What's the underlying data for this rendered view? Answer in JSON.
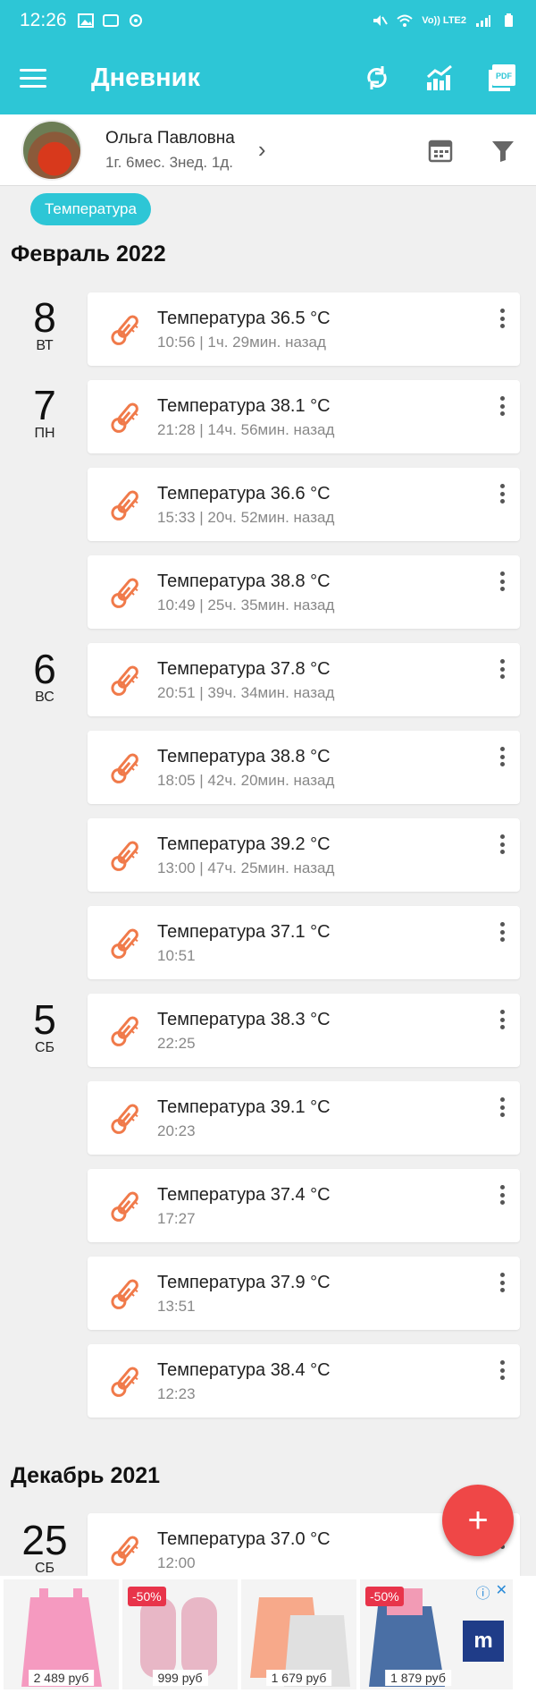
{
  "status_bar": {
    "time": "12:26",
    "carrier": "Vo)) LTE2"
  },
  "app_bar": {
    "title": "Дневник",
    "icons": [
      "menu-icon",
      "sync-icon",
      "stats-icon",
      "pdf-icon"
    ],
    "pdf_label": "PDF"
  },
  "profile": {
    "name": "Ольга Павловна",
    "age": "1г. 6мес. 3нед. 1д."
  },
  "filter_chip": "Температура",
  "months": [
    {
      "label": "Февраль 2022"
    },
    {
      "label": "Декабрь 2021"
    }
  ],
  "days": [
    {
      "num": "8",
      "weekday": "ВТ"
    },
    {
      "num": "7",
      "weekday": "ПН"
    },
    {
      "num": "6",
      "weekday": "ВС"
    },
    {
      "num": "5",
      "weekday": "СБ"
    },
    {
      "num": "25",
      "weekday": "СБ"
    }
  ],
  "entries": [
    {
      "title": "Температура 36.5 °C",
      "time": "10:56",
      "ago": "1ч. 29мин. назад"
    },
    {
      "title": "Температура 38.1 °C",
      "time": "21:28",
      "ago": "14ч. 56мин. назад"
    },
    {
      "title": "Температура 36.6 °C",
      "time": "15:33",
      "ago": "20ч. 52мин. назад"
    },
    {
      "title": "Температура 38.8 °C",
      "time": "10:49",
      "ago": "25ч. 35мин. назад"
    },
    {
      "title": "Температура 37.8 °C",
      "time": "20:51",
      "ago": "39ч. 34мин. назад"
    },
    {
      "title": "Температура 38.8 °C",
      "time": "18:05",
      "ago": "42ч. 20мин. назад"
    },
    {
      "title": "Температура 39.2 °C",
      "time": "13:00",
      "ago": "47ч. 25мин. назад"
    },
    {
      "title": "Температура 37.1 °C",
      "time": "10:51",
      "ago": ""
    },
    {
      "title": "Температура 38.3 °C",
      "time": "22:25",
      "ago": ""
    },
    {
      "title": "Температура 39.1 °C",
      "time": "20:23",
      "ago": ""
    },
    {
      "title": "Температура 37.4 °C",
      "time": "17:27",
      "ago": ""
    },
    {
      "title": "Температура 37.9 °C",
      "time": "13:51",
      "ago": ""
    },
    {
      "title": "Температура 38.4 °C",
      "time": "12:23",
      "ago": ""
    },
    {
      "title": "Температура 37.0 °C",
      "time": "12:00",
      "ago": ""
    }
  ],
  "fab_label": "+",
  "ad": {
    "items": [
      {
        "price": "2 489 руб",
        "discount": ""
      },
      {
        "price": "999 руб",
        "discount": "-50%"
      },
      {
        "price": "1 679 руб",
        "discount": ""
      },
      {
        "price": "1 879 руб",
        "discount": "-50%"
      }
    ],
    "logo": "m"
  },
  "colors": {
    "accent": "#2dc6d6",
    "fab": "#ef4747",
    "thermometer": "#f07a4a"
  }
}
